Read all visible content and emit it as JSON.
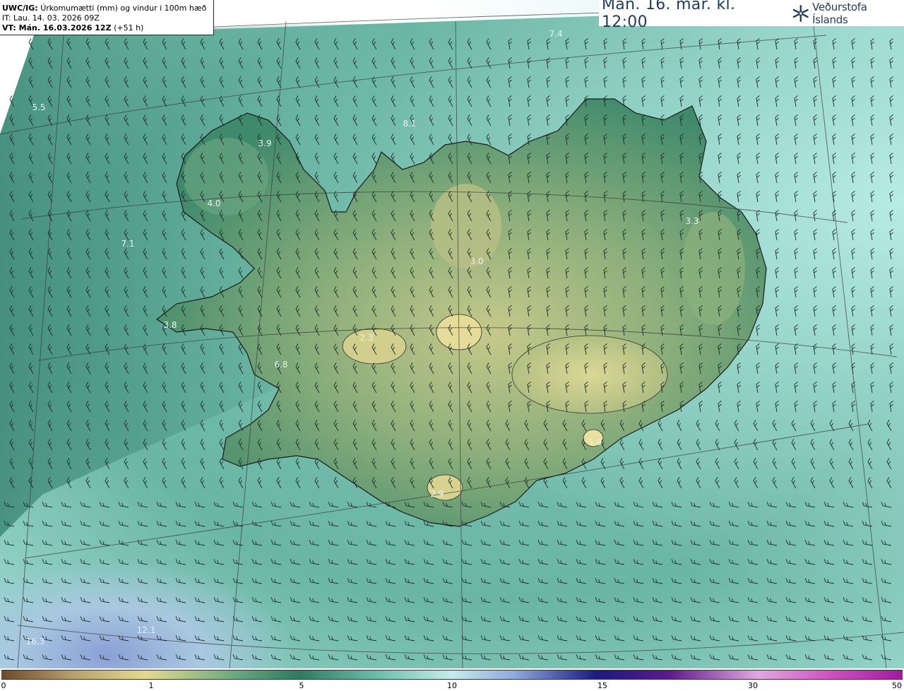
{
  "info": {
    "model_label": "UWC/IG:",
    "field_desc": "Úrkomumætti (mm) og vindur i 100m hæð",
    "init_time": "IT: Lau. 14. 03. 2026 09Z",
    "valid_label": "VT: Mán. 16.03.2026 12Z",
    "valid_lead": "(+51 h)"
  },
  "header": {
    "valid_title": "Mán. 16. mar. kl. 12:00",
    "logo_text": "Veðurstofa Íslands"
  },
  "colorbar": {
    "ticks": [
      "0",
      "1",
      "5",
      "10",
      "15",
      "30",
      "50"
    ]
  },
  "map_values": [
    {
      "id": "v1",
      "text": "7.4"
    },
    {
      "id": "v2",
      "text": "5.5"
    },
    {
      "id": "v3",
      "text": "8.1"
    },
    {
      "id": "v4",
      "text": "3.9"
    },
    {
      "id": "v5",
      "text": "4.0"
    },
    {
      "id": "v6",
      "text": "7.1"
    },
    {
      "id": "v7",
      "text": "3.3"
    },
    {
      "id": "v8",
      "text": "3.0"
    },
    {
      "id": "v9",
      "text": "3.8"
    },
    {
      "id": "v10",
      "text": "2.3"
    },
    {
      "id": "v11",
      "text": "6.8"
    },
    {
      "id": "v12",
      "text": "1.9"
    },
    {
      "id": "v13",
      "text": "2.9"
    },
    {
      "id": "v14",
      "text": "12.1"
    },
    {
      "id": "v15",
      "text": "16.3"
    }
  ],
  "colors": {
    "ocean": "#6fbcae",
    "ocean_light": "#a8e0d8",
    "land_dark": "#2f7a62",
    "land_mid": "#5f9e72",
    "land_high": "#c8cc8c",
    "precip_blue": "#8aa6d8",
    "coast": "#1a1a1a",
    "barb": "#1e2a2a",
    "brand": "#1f3b5a"
  }
}
